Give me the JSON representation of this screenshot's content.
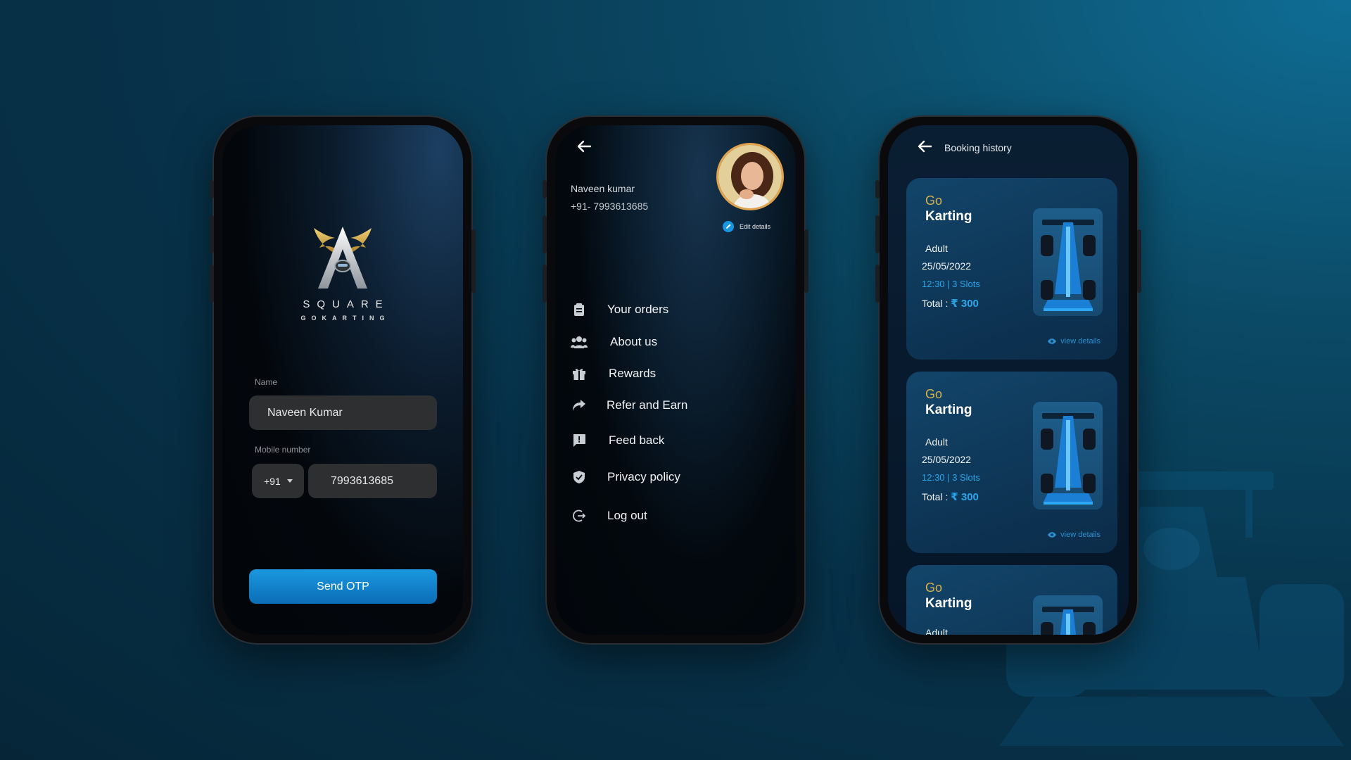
{
  "colors": {
    "accent": "#1996e0",
    "gold": "#d8b04c",
    "card": "#0e3657",
    "screen": "#02060b"
  },
  "login": {
    "logo_icon": "winged-a-logo",
    "brand_line1": "SQUARE",
    "brand_line2": "GOKARTING",
    "name_label": "Name",
    "name_value": "Naveen Kumar",
    "mobile_label": "Mobile number",
    "country_code": "+91",
    "mobile_value": "7993613685",
    "send_otp": "Send OTP"
  },
  "profile": {
    "name": "Naveen kumar",
    "phone": "+91- 7993613685",
    "edit_details": "Edit details",
    "menu": [
      {
        "icon": "clipboard-icon",
        "label": "Your orders"
      },
      {
        "icon": "users-icon",
        "label": "About us"
      },
      {
        "icon": "gift-icon",
        "label": "Rewards"
      },
      {
        "icon": "share-icon",
        "label": "Refer and Earn"
      },
      {
        "icon": "feedback-icon",
        "label": "Feed back"
      },
      {
        "icon": "shield-icon",
        "label": "Privacy policy"
      },
      {
        "icon": "logout-icon",
        "label": "Log out"
      }
    ]
  },
  "booking": {
    "title": "Booking history",
    "cards": [
      {
        "go": "Go",
        "title": "Karting",
        "type": "Adult",
        "date": "25/05/2022",
        "slot": "12:30 |  3 Slots",
        "total_label": "Total :",
        "amount": "₹ 300",
        "view": "view details"
      },
      {
        "go": "Go",
        "title": "Karting",
        "type": "Adult",
        "date": "25/05/2022",
        "slot": "12:30 |  3 Slots",
        "total_label": "Total :",
        "amount": "₹ 300",
        "view": "view details"
      },
      {
        "go": "Go",
        "title": "Karting",
        "type": "Adult"
      }
    ]
  }
}
